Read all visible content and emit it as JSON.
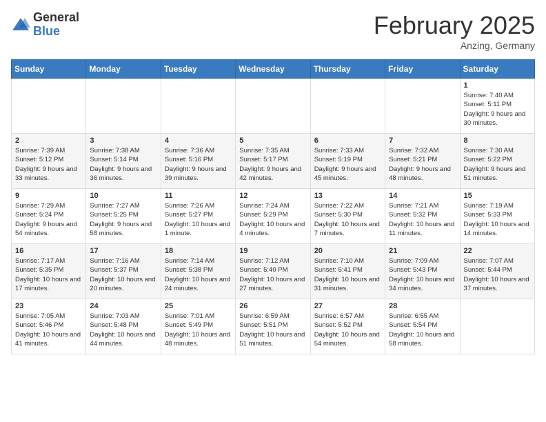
{
  "header": {
    "logo_general": "General",
    "logo_blue": "Blue",
    "month_title": "February 2025",
    "location": "Anzing, Germany"
  },
  "weekdays": [
    "Sunday",
    "Monday",
    "Tuesday",
    "Wednesday",
    "Thursday",
    "Friday",
    "Saturday"
  ],
  "weeks": [
    {
      "days": [
        {
          "num": "",
          "info": ""
        },
        {
          "num": "",
          "info": ""
        },
        {
          "num": "",
          "info": ""
        },
        {
          "num": "",
          "info": ""
        },
        {
          "num": "",
          "info": ""
        },
        {
          "num": "",
          "info": ""
        },
        {
          "num": "1",
          "info": "Sunrise: 7:40 AM\nSunset: 5:11 PM\nDaylight: 9 hours and 30 minutes."
        }
      ]
    },
    {
      "days": [
        {
          "num": "2",
          "info": "Sunrise: 7:39 AM\nSunset: 5:12 PM\nDaylight: 9 hours and 33 minutes."
        },
        {
          "num": "3",
          "info": "Sunrise: 7:38 AM\nSunset: 5:14 PM\nDaylight: 9 hours and 36 minutes."
        },
        {
          "num": "4",
          "info": "Sunrise: 7:36 AM\nSunset: 5:16 PM\nDaylight: 9 hours and 39 minutes."
        },
        {
          "num": "5",
          "info": "Sunrise: 7:35 AM\nSunset: 5:17 PM\nDaylight: 9 hours and 42 minutes."
        },
        {
          "num": "6",
          "info": "Sunrise: 7:33 AM\nSunset: 5:19 PM\nDaylight: 9 hours and 45 minutes."
        },
        {
          "num": "7",
          "info": "Sunrise: 7:32 AM\nSunset: 5:21 PM\nDaylight: 9 hours and 48 minutes."
        },
        {
          "num": "8",
          "info": "Sunrise: 7:30 AM\nSunset: 5:22 PM\nDaylight: 9 hours and 51 minutes."
        }
      ]
    },
    {
      "days": [
        {
          "num": "9",
          "info": "Sunrise: 7:29 AM\nSunset: 5:24 PM\nDaylight: 9 hours and 54 minutes."
        },
        {
          "num": "10",
          "info": "Sunrise: 7:27 AM\nSunset: 5:25 PM\nDaylight: 9 hours and 58 minutes."
        },
        {
          "num": "11",
          "info": "Sunrise: 7:26 AM\nSunset: 5:27 PM\nDaylight: 10 hours and 1 minute."
        },
        {
          "num": "12",
          "info": "Sunrise: 7:24 AM\nSunset: 5:29 PM\nDaylight: 10 hours and 4 minutes."
        },
        {
          "num": "13",
          "info": "Sunrise: 7:22 AM\nSunset: 5:30 PM\nDaylight: 10 hours and 7 minutes."
        },
        {
          "num": "14",
          "info": "Sunrise: 7:21 AM\nSunset: 5:32 PM\nDaylight: 10 hours and 11 minutes."
        },
        {
          "num": "15",
          "info": "Sunrise: 7:19 AM\nSunset: 5:33 PM\nDaylight: 10 hours and 14 minutes."
        }
      ]
    },
    {
      "days": [
        {
          "num": "16",
          "info": "Sunrise: 7:17 AM\nSunset: 5:35 PM\nDaylight: 10 hours and 17 minutes."
        },
        {
          "num": "17",
          "info": "Sunrise: 7:16 AM\nSunset: 5:37 PM\nDaylight: 10 hours and 20 minutes."
        },
        {
          "num": "18",
          "info": "Sunrise: 7:14 AM\nSunset: 5:38 PM\nDaylight: 10 hours and 24 minutes."
        },
        {
          "num": "19",
          "info": "Sunrise: 7:12 AM\nSunset: 5:40 PM\nDaylight: 10 hours and 27 minutes."
        },
        {
          "num": "20",
          "info": "Sunrise: 7:10 AM\nSunset: 5:41 PM\nDaylight: 10 hours and 31 minutes."
        },
        {
          "num": "21",
          "info": "Sunrise: 7:09 AM\nSunset: 5:43 PM\nDaylight: 10 hours and 34 minutes."
        },
        {
          "num": "22",
          "info": "Sunrise: 7:07 AM\nSunset: 5:44 PM\nDaylight: 10 hours and 37 minutes."
        }
      ]
    },
    {
      "days": [
        {
          "num": "23",
          "info": "Sunrise: 7:05 AM\nSunset: 5:46 PM\nDaylight: 10 hours and 41 minutes."
        },
        {
          "num": "24",
          "info": "Sunrise: 7:03 AM\nSunset: 5:48 PM\nDaylight: 10 hours and 44 minutes."
        },
        {
          "num": "25",
          "info": "Sunrise: 7:01 AM\nSunset: 5:49 PM\nDaylight: 10 hours and 48 minutes."
        },
        {
          "num": "26",
          "info": "Sunrise: 6:59 AM\nSunset: 5:51 PM\nDaylight: 10 hours and 51 minutes."
        },
        {
          "num": "27",
          "info": "Sunrise: 6:57 AM\nSunset: 5:52 PM\nDaylight: 10 hours and 54 minutes."
        },
        {
          "num": "28",
          "info": "Sunrise: 6:55 AM\nSunset: 5:54 PM\nDaylight: 10 hours and 58 minutes."
        },
        {
          "num": "",
          "info": ""
        }
      ]
    }
  ]
}
